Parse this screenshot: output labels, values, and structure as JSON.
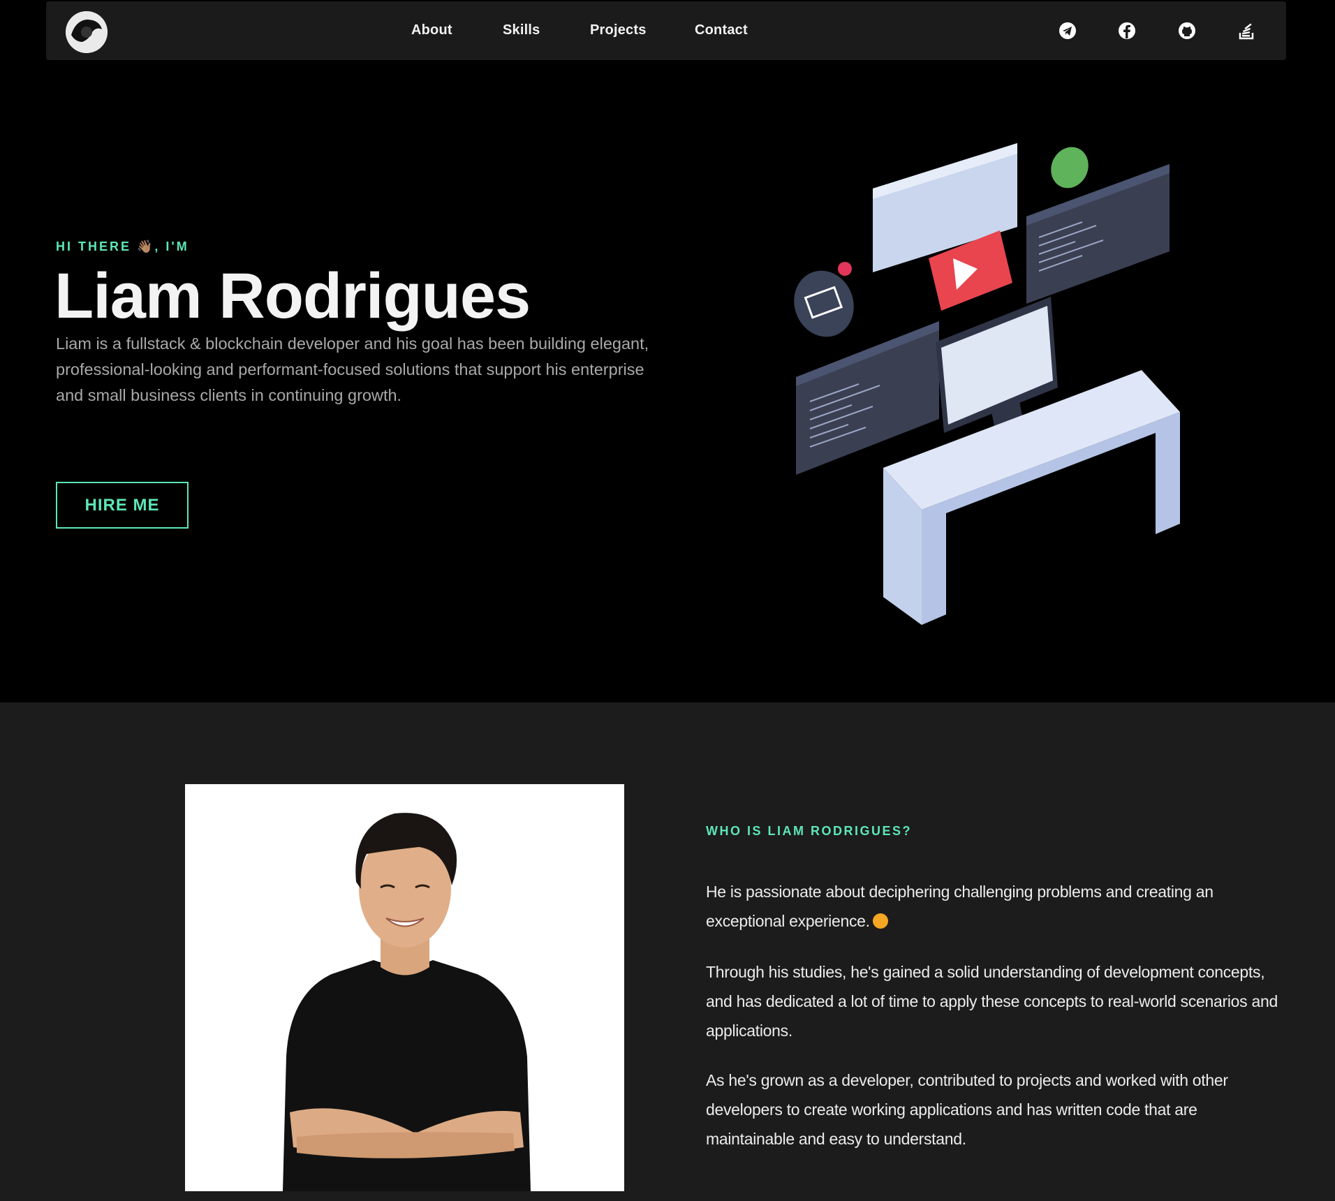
{
  "nav": {
    "links": [
      {
        "label": "About"
      },
      {
        "label": "Skills"
      },
      {
        "label": "Projects"
      },
      {
        "label": "Contact"
      }
    ],
    "socials": [
      "telegram-icon",
      "facebook-icon",
      "github-icon",
      "stackoverflow-icon"
    ]
  },
  "hero": {
    "greeting": "HI THERE 👋🏽, I'M",
    "name": "Liam Rodrigues",
    "description": "Liam is a fullstack & blockchain developer and his goal has been building elegant, professional-looking and performant-focused solutions that support his enterprise and small business clients in continuing growth.",
    "cta_label": "HIRE ME"
  },
  "about": {
    "heading": "WHO IS LIAM RODRIGUES?",
    "paragraphs": [
      "He is passionate about deciphering challenging problems and creating an exceptional experience.",
      "Through his studies, he's gained a solid understanding of development concepts, and has dedicated a lot of time to apply these concepts to real-world scenarios and applications.",
      "As he's grown as a developer, contributed to projects and worked with other developers to create working applications and has written code that are maintainable and easy to understand."
    ]
  },
  "colors": {
    "accent": "#5ee6b9",
    "background": "#000000",
    "nav_background": "#1b1b1b",
    "section_background": "#1c1c1c"
  }
}
